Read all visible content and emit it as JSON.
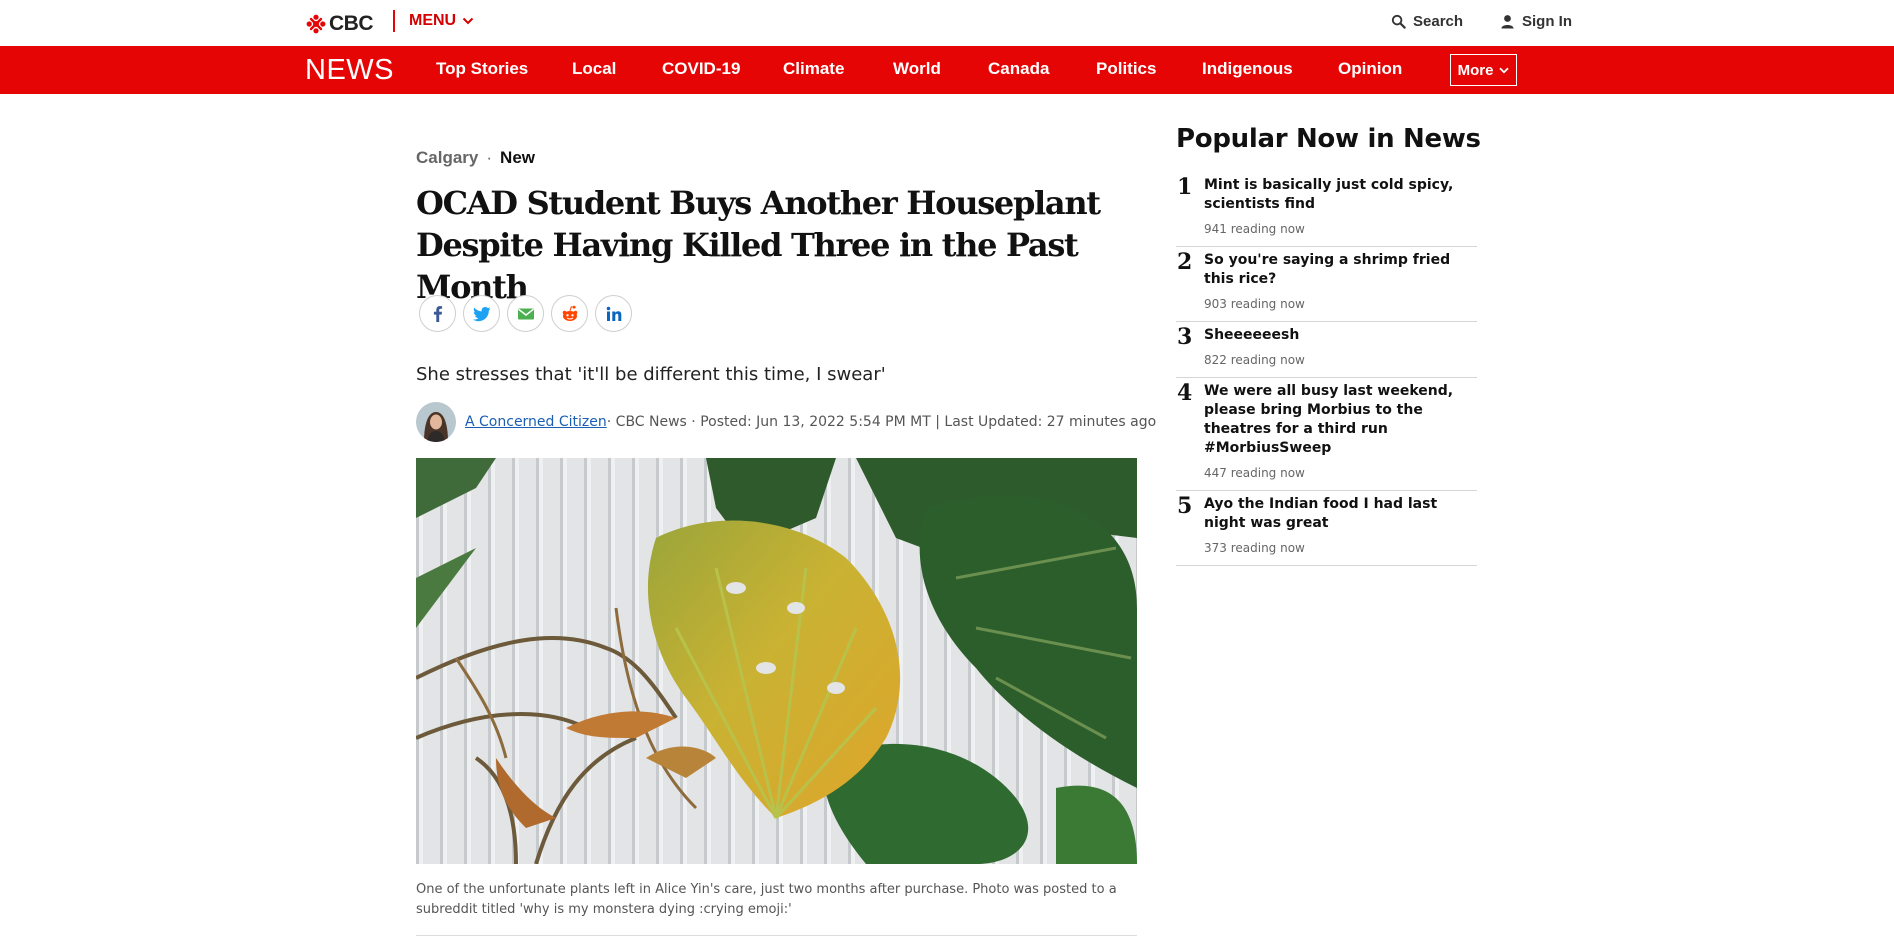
{
  "header": {
    "logo_text": "CBC",
    "menu_label": "MENU",
    "search_label": "Search",
    "signin_label": "Sign In"
  },
  "nav": {
    "section": "NEWS",
    "items": [
      "Top Stories",
      "Local",
      "COVID-19",
      "Climate",
      "World",
      "Canada",
      "Politics",
      "Indigenous",
      "Opinion"
    ],
    "more_label": "More"
  },
  "article": {
    "section": "Calgary",
    "tag": "New",
    "headline": "OCAD Student Buys Another Houseplant Despite Having Killed Three in the Past Month",
    "deck": "She stresses that 'it'll be different this time, I swear'",
    "author": "A Concerned Citizen",
    "byline_rest": " · CBC News · Posted: Jun 13, 2022 5:54 PM MT | Last Updated: 27 minutes ago",
    "caption": "One of the unfortunate plants left in Alice Yin's care, just two months after purchase. Photo was posted to a subreddit titled 'why is my monstera dying :crying emoji:'"
  },
  "share_icons": [
    "facebook-icon",
    "twitter-icon",
    "email-icon",
    "reddit-icon",
    "linkedin-icon"
  ],
  "popular": {
    "title": "Popular Now in News",
    "items": [
      {
        "rank": "1",
        "headline": "Mint is basically just cold spicy, scientists find",
        "count": "941 reading now"
      },
      {
        "rank": "2",
        "headline": "So you're saying a shrimp fried this rice?",
        "count": "903 reading now"
      },
      {
        "rank": "3",
        "headline": "Sheeeeeesh",
        "count": "822 reading now"
      },
      {
        "rank": "4",
        "headline": "We were all busy last weekend, please bring Morbius to the theatres for a third run #MorbiusSweep",
        "count": "447 reading now"
      },
      {
        "rank": "5",
        "headline": "Ayo the Indian food I had last night was great",
        "count": "373 reading now"
      }
    ]
  },
  "colors": {
    "brand_red": "#e60505",
    "link_blue": "#1a5fb4"
  }
}
